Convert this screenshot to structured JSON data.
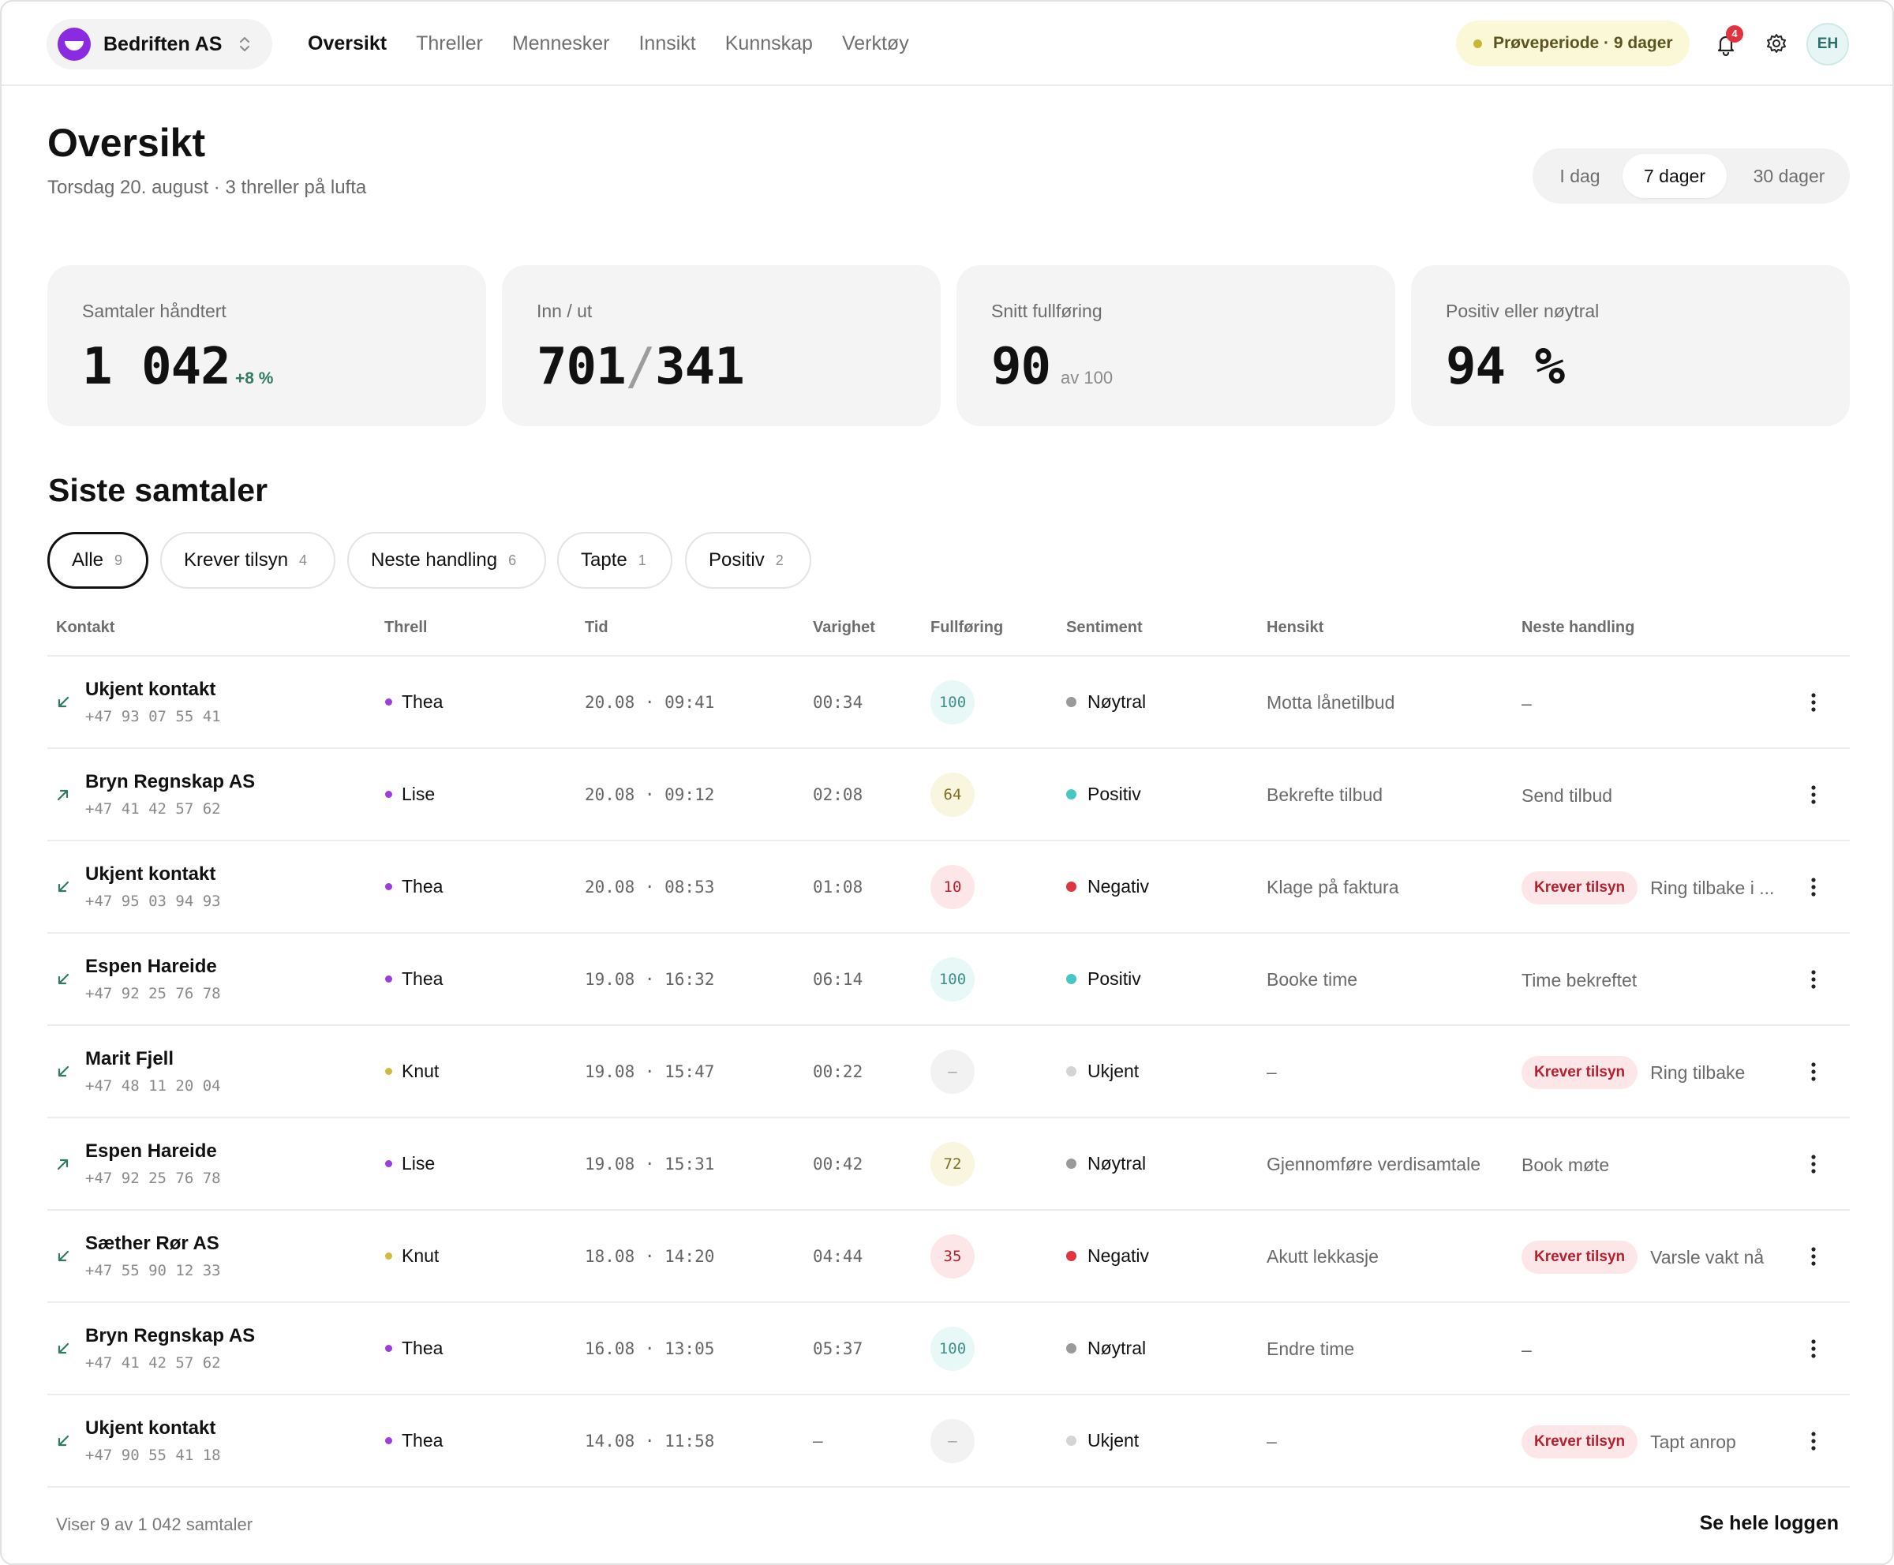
{
  "org": {
    "name": "Bedriften AS"
  },
  "nav": [
    "Oversikt",
    "Threller",
    "Mennesker",
    "Innsikt",
    "Kunnskap",
    "Verktøy"
  ],
  "trial": "Prøveperiode · 9 dager",
  "notifications": {
    "count": "4"
  },
  "user": {
    "initials": "EH"
  },
  "page": {
    "title": "Oversikt",
    "subtitle": "Torsdag 20. august · 3 threller på lufta"
  },
  "range": {
    "options": [
      "I dag",
      "7 dager",
      "30 dager"
    ],
    "selected": "7 dager"
  },
  "stats": [
    {
      "label": "Samtaler håndtert",
      "value": "1 042",
      "delta": "+8 %"
    },
    {
      "label": "Inn / ut",
      "value_in": "701",
      "separator": "/",
      "value_out": "341"
    },
    {
      "label": "Snitt fullføring",
      "value": "90",
      "suffix": "av 100"
    },
    {
      "label": "Positiv eller nøytral",
      "value": "94 %"
    }
  ],
  "section": {
    "title": "Siste samtaler"
  },
  "filters": [
    {
      "label": "Alle",
      "count": "9",
      "active": true
    },
    {
      "label": "Krever tilsyn",
      "count": "4"
    },
    {
      "label": "Neste handling",
      "count": "6"
    },
    {
      "label": "Tapte",
      "count": "1"
    },
    {
      "label": "Positiv",
      "count": "2"
    }
  ],
  "columns": [
    "Kontakt",
    "Threll",
    "Tid",
    "Varighet",
    "Fullføring",
    "Sentiment",
    "Hensikt",
    "Neste handling"
  ],
  "colors": {
    "thread_purple": "#9b3de0",
    "thread_yellow": "#d1b93c",
    "sent_neutral": "#9a9a9a",
    "sent_positive": "#46c7c2",
    "sent_negative": "#e23342",
    "sent_unknown": "#d4d4d4",
    "score_high_bg": "#e8f8f7",
    "score_mid_bg": "#f8f6df",
    "score_low_bg": "#fde6e7"
  },
  "rows": [
    {
      "direction": "inbound",
      "name": "Ukjent kontakt",
      "phone": "+47 93 07 55 41",
      "thread": "Thea",
      "thread_color": "purple",
      "time": "20.08 · 09:41",
      "duration": "00:34",
      "score": "100",
      "score_level": "high",
      "sentiment": "Nøytral",
      "sentiment_type": "neutral",
      "intent": "Motta lånetilbud",
      "next": "–",
      "needs_attention": false
    },
    {
      "direction": "outbound",
      "name": "Bryn Regnskap AS",
      "phone": "+47 41 42 57 62",
      "thread": "Lise",
      "thread_color": "purple",
      "time": "20.08 · 09:12",
      "duration": "02:08",
      "score": "64",
      "score_level": "mid",
      "sentiment": "Positiv",
      "sentiment_type": "positive",
      "intent": "Bekrefte tilbud",
      "next": "Send tilbud",
      "needs_attention": false
    },
    {
      "direction": "inbound",
      "name": "Ukjent kontakt",
      "phone": "+47 95 03 94 93",
      "thread": "Thea",
      "thread_color": "purple",
      "time": "20.08 · 08:53",
      "duration": "01:08",
      "score": "10",
      "score_level": "low",
      "sentiment": "Negativ",
      "sentiment_type": "negative",
      "intent": "Klage på faktura",
      "next": "Ring tilbake i ...",
      "needs_attention": true
    },
    {
      "direction": "inbound",
      "name": "Espen Hareide",
      "phone": "+47 92 25 76 78",
      "thread": "Thea",
      "thread_color": "purple",
      "time": "19.08 · 16:32",
      "duration": "06:14",
      "score": "100",
      "score_level": "high",
      "sentiment": "Positiv",
      "sentiment_type": "positive",
      "intent": "Booke time",
      "next": "Time bekreftet",
      "needs_attention": false
    },
    {
      "direction": "inbound",
      "name": "Marit Fjell",
      "phone": "+47 48 11 20 04",
      "thread": "Knut",
      "thread_color": "yellow",
      "time": "19.08 · 15:47",
      "duration": "00:22",
      "score": "–",
      "score_level": "none",
      "sentiment": "Ukjent",
      "sentiment_type": "unknown",
      "intent": "–",
      "next": "Ring tilbake",
      "needs_attention": true
    },
    {
      "direction": "outbound",
      "name": "Espen Hareide",
      "phone": "+47 92 25 76 78",
      "thread": "Lise",
      "thread_color": "purple",
      "time": "19.08 · 15:31",
      "duration": "00:42",
      "score": "72",
      "score_level": "mid",
      "sentiment": "Nøytral",
      "sentiment_type": "neutral",
      "intent": "Gjennomføre verdisamtale",
      "next": "Book møte",
      "needs_attention": false
    },
    {
      "direction": "inbound",
      "name": "Sæther Rør AS",
      "phone": "+47 55 90 12 33",
      "thread": "Knut",
      "thread_color": "yellow",
      "time": "18.08 · 14:20",
      "duration": "04:44",
      "score": "35",
      "score_level": "low",
      "sentiment": "Negativ",
      "sentiment_type": "negative",
      "intent": "Akutt lekkasje",
      "next": "Varsle vakt nå",
      "needs_attention": true
    },
    {
      "direction": "inbound",
      "name": "Bryn Regnskap AS",
      "phone": "+47 41 42 57 62",
      "thread": "Thea",
      "thread_color": "purple",
      "time": "16.08 · 13:05",
      "duration": "05:37",
      "score": "100",
      "score_level": "high",
      "sentiment": "Nøytral",
      "sentiment_type": "neutral",
      "intent": "Endre time",
      "next": "–",
      "needs_attention": false
    },
    {
      "direction": "inbound",
      "name": "Ukjent kontakt",
      "phone": "+47 90 55 41 18",
      "thread": "Thea",
      "thread_color": "purple",
      "time": "14.08 · 11:58",
      "duration": "–",
      "score": "–",
      "score_level": "none",
      "sentiment": "Ukjent",
      "sentiment_type": "unknown",
      "intent": "–",
      "next": "Tapt anrop",
      "needs_attention": true
    }
  ],
  "attention_label": "Krever tilsyn",
  "footer": {
    "count_text": "Viser 9 av 1 042 samtaler",
    "link": "Se hele loggen"
  }
}
